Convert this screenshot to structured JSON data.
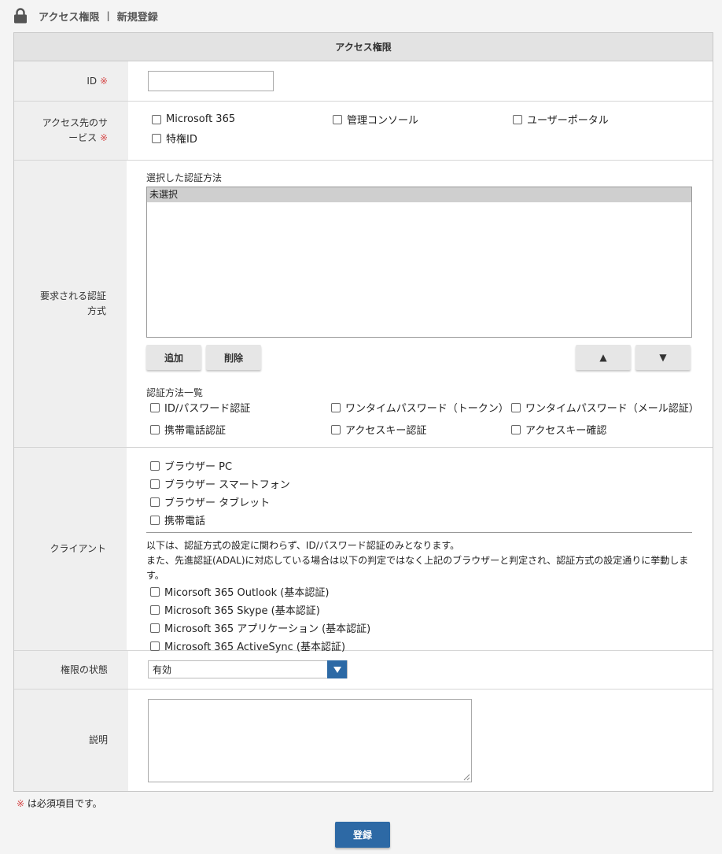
{
  "header": {
    "crumb_1": "アクセス権限",
    "separator": "|",
    "crumb_2": "新規登録"
  },
  "form": {
    "title": "アクセス権限",
    "required_mark": "※",
    "id_row": {
      "label": "ID",
      "value": ""
    },
    "services_row": {
      "label_line1": "アクセス先のサ",
      "label_line2": "ービス",
      "options": [
        "Microsoft 365",
        "管理コンソール",
        "ユーザーポータル",
        "特権ID"
      ]
    },
    "auth_row": {
      "label_line1": "要求される認証",
      "label_line2": "方式",
      "selected_label": "選択した認証方法",
      "selected_items": [
        "未選択"
      ],
      "add_label": "追加",
      "delete_label": "削除",
      "up_label": "▲",
      "down_label": "▼",
      "list_label": "認証方法一覧",
      "methods": [
        "ID/パスワード認証",
        "ワンタイムパスワード（トークン）",
        "ワンタイムパスワード（メール認証）",
        "携帯電話認証",
        "アクセスキー認証",
        "アクセスキー確認"
      ]
    },
    "client_row": {
      "label": "クライアント",
      "options": [
        "ブラウザー PC",
        "ブラウザー スマートフォン",
        "ブラウザー タブレット",
        "携帯電話"
      ],
      "note_line1": "以下は、認証方式の設定に関わらず、ID/パスワード認証のみとなります。",
      "note_line2": "また、先進認証(ADAL)に対応している場合は以下の判定ではなく上記のブラウザーと判定され、認証方式の設定通りに挙動しま",
      "note_line3": "す。",
      "legacy_options": [
        "Micorsoft 365 Outlook (基本認証)",
        "Microsoft 365 Skype (基本認証)",
        "Microsoft 365 アプリケーション (基本認証)",
        "Microsoft 365 ActiveSync (基本認証)"
      ]
    },
    "status_row": {
      "label": "権限の状態",
      "selected": "有効"
    },
    "description_row": {
      "label": "説明",
      "value": ""
    }
  },
  "footer": {
    "required_mark": "※",
    "required_note": " は必須項目です。",
    "submit_label": "登録"
  },
  "colors": {
    "primary_button": "#2d69a5",
    "required_mark": "#d64a4a",
    "label_bg": "#efefef",
    "header_bg": "#e3e3e3"
  },
  "icons": {
    "header": "lock-icon",
    "select_arrow": "triangle-down-icon"
  }
}
